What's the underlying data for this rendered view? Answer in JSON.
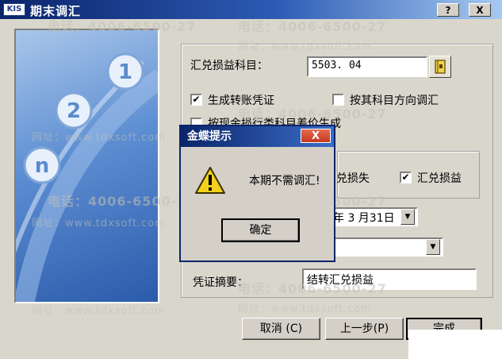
{
  "window": {
    "app_icon_text": "KIS",
    "title": "期末调汇",
    "help_label": "?",
    "close_label": "X"
  },
  "form": {
    "exchange_account_label": "汇兑损益科目：",
    "exchange_account_value": "5503. 04",
    "generate_voucher_label": "生成转账凭证",
    "generate_voucher_checked": true,
    "adjust_by_direction_label": "按其科目方向调汇",
    "adjust_by_direction_checked": false,
    "partial_hidden_label": "按现金损行类科目差价生成",
    "exchange_loss_label": "兑损失",
    "exchange_gain_label": "汇兑损益",
    "exchange_gain_checked": true,
    "date_value": "年 3 月31日",
    "type_value": "",
    "summary_label": "凭证摘要：",
    "summary_value": "结转汇兑损益"
  },
  "buttons": {
    "cancel": "取消 (C)",
    "prev": "上一步(P)",
    "finish": "完成"
  },
  "modal": {
    "title": "金蝶提示",
    "close_label": "X",
    "message": "本期不需调汇!",
    "ok_label": "确定"
  },
  "panel_numbers": [
    "1",
    "2",
    "n"
  ],
  "watermark": {
    "phone": "电话：4006-6500-27",
    "site": "网址：www.tdxsoft.com"
  },
  "colors": {
    "title_bar": "#0a246a",
    "panel_blue": "#2b5bab",
    "modal_close": "#c4391f"
  }
}
